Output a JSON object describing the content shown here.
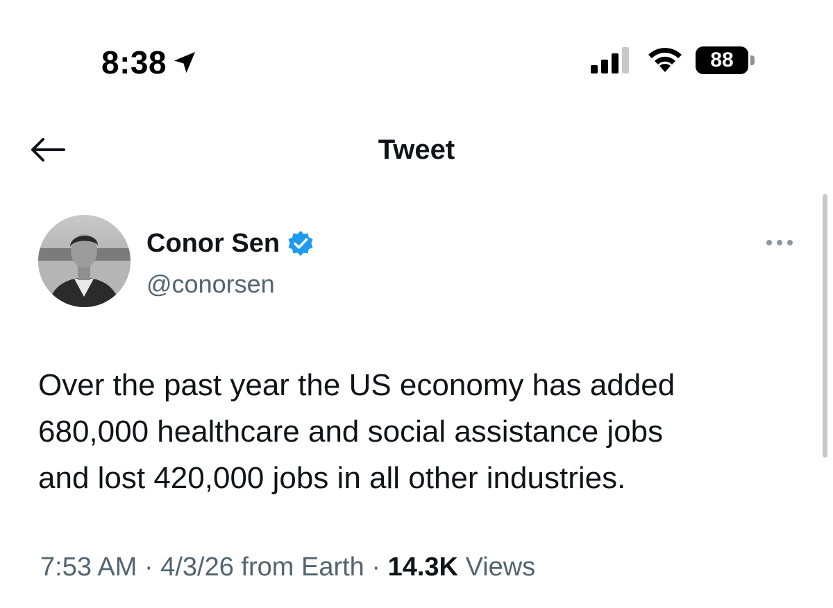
{
  "status_bar": {
    "time": "8:38",
    "battery_level": "88",
    "icons": [
      "location-arrow-icon",
      "cellular-signal-icon",
      "wifi-icon",
      "battery-icon"
    ]
  },
  "header": {
    "title": "Tweet",
    "back_icon": "back-arrow-icon"
  },
  "author": {
    "display_name": "Conor Sen",
    "handle": "@conorsen",
    "verified": true,
    "verified_color": "#1d9bf0"
  },
  "tweet": {
    "lines": [
      "Over the past year the US economy has added",
      "680,000 healthcare and social assistance jobs",
      "and lost 420,000 jobs in all other industries."
    ]
  },
  "meta": {
    "time": "7:53 AM",
    "date": "4/3/26",
    "source": "from Earth",
    "separator": " · ",
    "views_count": "14.3K",
    "views_label": "Views"
  },
  "colors": {
    "text_primary": "#0f1419",
    "text_secondary": "#536471",
    "accent": "#1d9bf0"
  }
}
